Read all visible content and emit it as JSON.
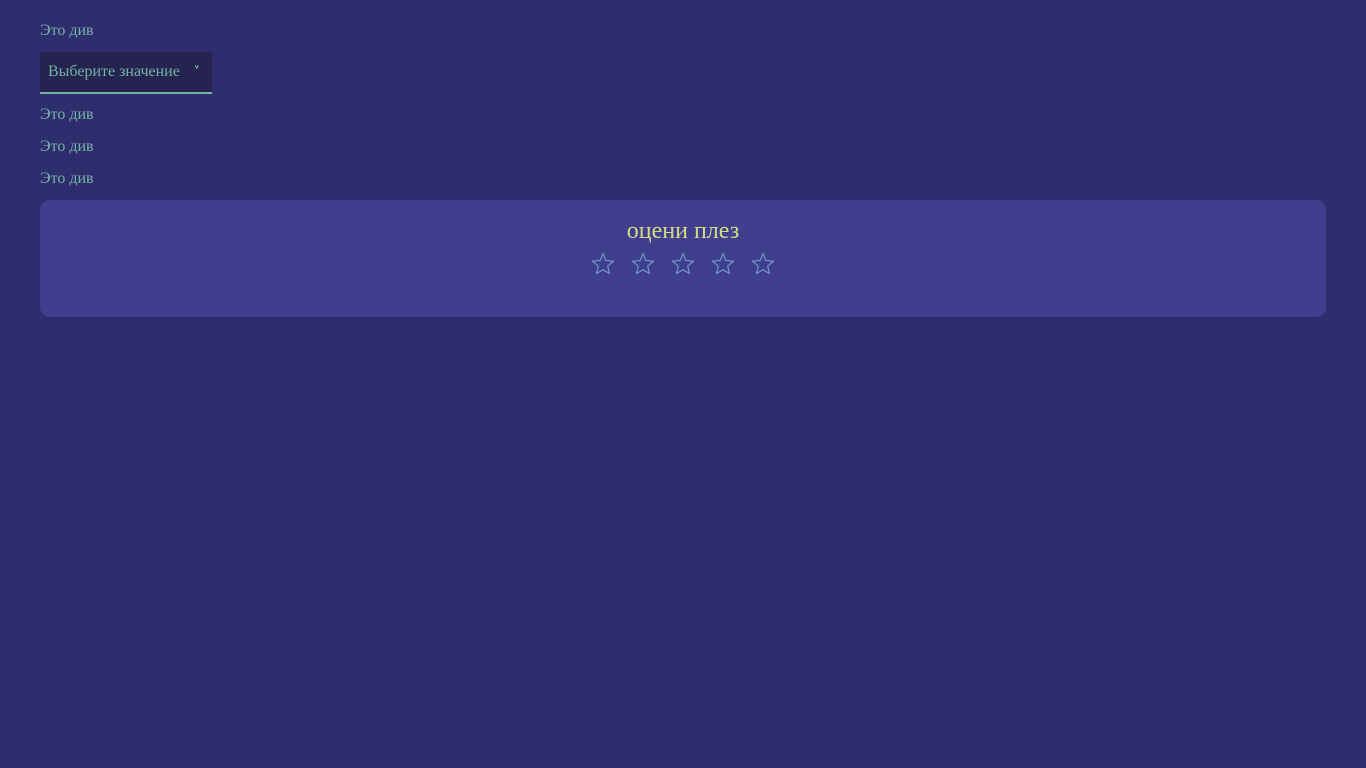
{
  "divs": [
    "Это див",
    "Это див",
    "Это див",
    "Это див"
  ],
  "select": {
    "value": "Выберите значение",
    "chevron": "˅"
  },
  "rating": {
    "title": "оцени плез",
    "stars_total": 5,
    "stars_selected": 0,
    "star_icon": "star-outline-icon",
    "star_color": "#6fa0c0"
  },
  "colors": {
    "background": "#302d6f",
    "card": "#413e8f",
    "text": "#74b3a6",
    "title": "#d2de82",
    "select_bg": "#25234f",
    "select_border": "#6fb5a3"
  }
}
